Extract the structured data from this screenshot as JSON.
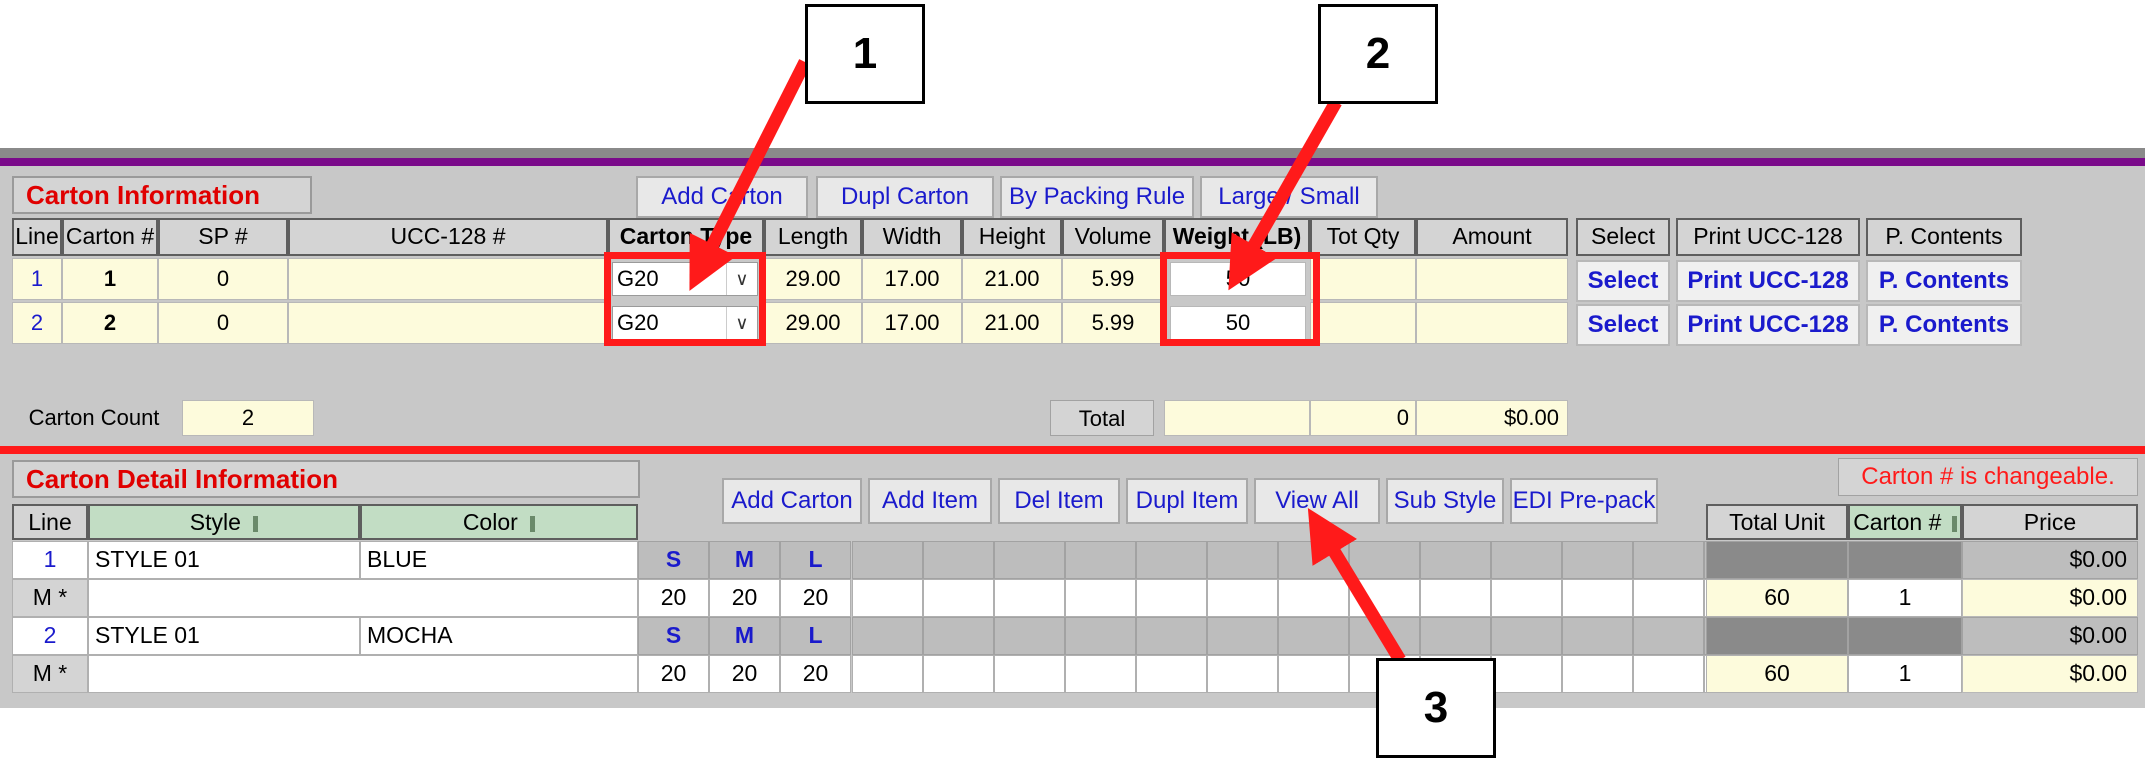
{
  "carton_info": {
    "title": "Carton  Information",
    "buttons": [
      "Add Carton",
      "Dupl Carton",
      "By Packing Rule",
      "Large / Small"
    ],
    "columns": [
      "Line",
      "Carton #",
      "SP #",
      "UCC-128 #",
      "Carton Type",
      "Length",
      "Width",
      "Height",
      "Volume",
      "Weight (LB)",
      "Tot Qty",
      "Amount",
      "Select",
      "Print UCC-128",
      "P. Contents"
    ],
    "rows": [
      {
        "line": "1",
        "carton": "1",
        "sp": "0",
        "ucc": "",
        "type": "G20",
        "length": "29.00",
        "width": "17.00",
        "height": "21.00",
        "volume": "5.99",
        "weight": "50",
        "tot_qty": "",
        "amount": "",
        "select": "Select",
        "print": "Print UCC-128",
        "contents": "P. Contents"
      },
      {
        "line": "2",
        "carton": "2",
        "sp": "0",
        "ucc": "",
        "type": "G20",
        "length": "29.00",
        "width": "17.00",
        "height": "21.00",
        "volume": "5.99",
        "weight": "50",
        "tot_qty": "",
        "amount": "",
        "select": "Select",
        "print": "Print UCC-128",
        "contents": "P. Contents"
      }
    ],
    "carton_count_label": "Carton Count",
    "carton_count": "2",
    "total_label": "Total",
    "total_weight": "",
    "total_qty": "0",
    "total_amount": "$0.00"
  },
  "detail_info": {
    "title": "Carton Detail Information",
    "note": "Carton # is changeable.",
    "buttons": [
      "Add Carton",
      "Add Item",
      "Del Item",
      "Dupl Item",
      "View All",
      "Sub Style",
      "EDI Pre-pack"
    ],
    "columns": {
      "line": "Line",
      "style": "Style",
      "color": "Color",
      "total_unit": "Total Unit",
      "carton": "Carton #",
      "price": "Price"
    },
    "items": [
      {
        "line": "1",
        "style": "STYLE 01",
        "color": "BLUE",
        "sizes": [
          "S",
          "M",
          "L"
        ],
        "price_top": "$0.00",
        "mark": "M *",
        "qty": [
          "20",
          "20",
          "20"
        ],
        "total_unit": "60",
        "carton": "1",
        "price": "$0.00"
      },
      {
        "line": "2",
        "style": "STYLE 01",
        "color": "MOCHA",
        "sizes": [
          "S",
          "M",
          "L"
        ],
        "price_top": "$0.00",
        "mark": "M *",
        "qty": [
          "20",
          "20",
          "20"
        ],
        "total_unit": "60",
        "carton": "1",
        "price": "$0.00"
      }
    ]
  },
  "callouts": [
    "1",
    "2",
    "3"
  ],
  "colors": {
    "accent_red": "#ff1a1a",
    "title_red": "#e00000",
    "link_blue": "#1a1acc",
    "top_bar": "#7a0a8a"
  }
}
